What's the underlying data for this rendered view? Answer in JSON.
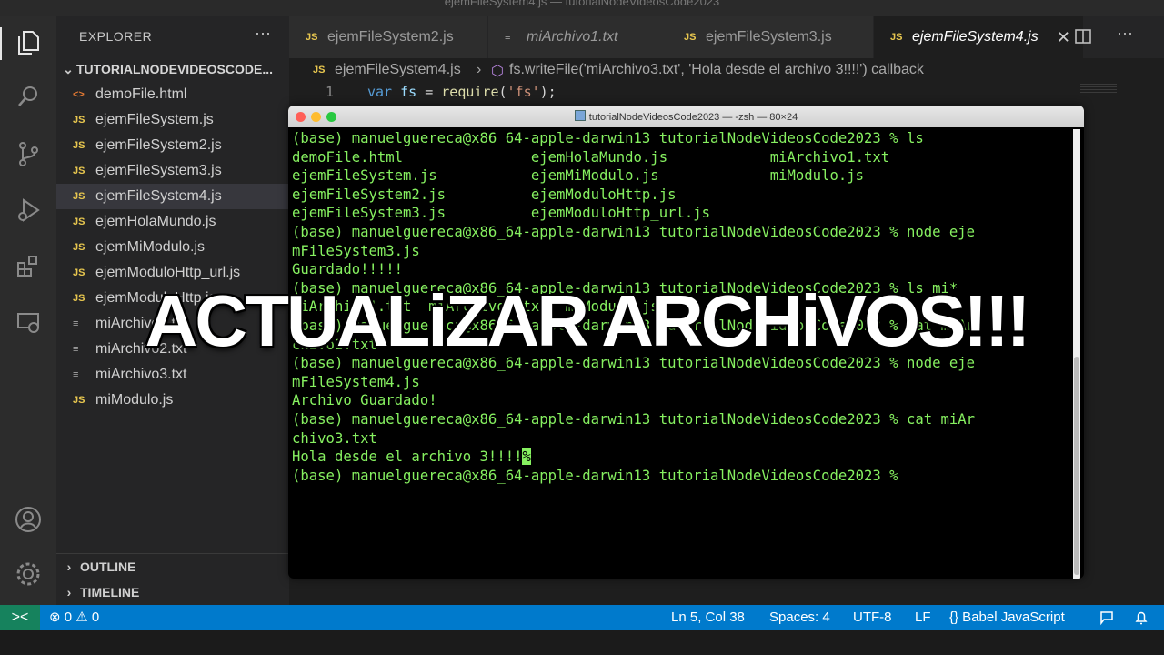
{
  "window": {
    "title": "ejemFileSystem4.js — tutorialNodeVideosCode2023"
  },
  "explorer": {
    "header": "EXPLORER",
    "more": "···",
    "folder": "TUTORIALNODEVIDEOSCODE...",
    "files": [
      {
        "name": "demoFile.html",
        "icon": "<>"
      },
      {
        "name": "ejemFileSystem.js",
        "icon": "JS"
      },
      {
        "name": "ejemFileSystem2.js",
        "icon": "JS"
      },
      {
        "name": "ejemFileSystem3.js",
        "icon": "JS"
      },
      {
        "name": "ejemFileSystem4.js",
        "icon": "JS"
      },
      {
        "name": "ejemHolaMundo.js",
        "icon": "JS"
      },
      {
        "name": "ejemMiModulo.js",
        "icon": "JS"
      },
      {
        "name": "ejemModuloHttp_url.js",
        "icon": "JS"
      },
      {
        "name": "ejemModuloHttp.js",
        "icon": "JS"
      },
      {
        "name": "miArchivo1.txt",
        "icon": "≡"
      },
      {
        "name": "miArchivo2.txt",
        "icon": "≡"
      },
      {
        "name": "miArchivo3.txt",
        "icon": "≡"
      },
      {
        "name": "miModulo.js",
        "icon": "JS"
      }
    ],
    "outline": "OUTLINE",
    "timeline": "TIMELINE"
  },
  "tabs": [
    {
      "label": "ejemFileSystem2.js",
      "icon": "JS"
    },
    {
      "label": "miArchivo1.txt",
      "icon": "≡"
    },
    {
      "label": "ejemFileSystem3.js",
      "icon": "JS"
    },
    {
      "label": "ejemFileSystem4.js",
      "icon": "JS",
      "close": "✕"
    }
  ],
  "breadcrumb": {
    "file": "ejemFileSystem4.js",
    "sep": "›",
    "symbol": "fs.writeFile('miArchivo3.txt', 'Hola desde el archivo 3!!!!') callback"
  },
  "editor": {
    "line_number": "1",
    "code": {
      "kw": "var",
      "var": "fs",
      "eq": " = ",
      "fn": "require",
      "open": "(",
      "str": "'fs'",
      "close": ");"
    }
  },
  "terminal": {
    "title": "tutorialNodeVideosCode2023 — -zsh — 80×24",
    "lines": [
      "(base) manuelguereca@x86_64-apple-darwin13 tutorialNodeVideosCode2023 % ls",
      "demoFile.html               ejemHolaMundo.js            miArchivo1.txt",
      "ejemFileSystem.js           ejemMiModulo.js             miModulo.js",
      "ejemFileSystem2.js          ejemModuloHttp.js",
      "ejemFileSystem3.js          ejemModuloHttp_url.js",
      "(base) manuelguereca@x86_64-apple-darwin13 tutorialNodeVideosCode2023 % node eje",
      "mFileSystem3.js",
      "Guardado!!!!!",
      "(base) manuelguereca@x86_64-apple-darwin13 tutorialNodeVideosCode2023 % ls mi*",
      "miArchivo1.txt  miArchivo2.txt  miModulo.js",
      "(base) manuelguereca@x86_64-apple-darwin13 tutorialNodeVideosCode2023 % cat miAr",
      "chivo2.txt",
      "(base) manuelguereca@x86_64-apple-darwin13 tutorialNodeVideosCode2023 % node eje",
      "mFileSystem4.js",
      "Archivo Guardado!",
      "(base) manuelguereca@x86_64-apple-darwin13 tutorialNodeVideosCode2023 % cat miAr",
      "chivo3.txt",
      "Hola desde el archivo 3!!!!"
    ],
    "cursor_char": "%",
    "last_line": "(base) manuelguereca@x86_64-apple-darwin13 tutorialNodeVideosCode2023 %"
  },
  "overlay_text": "ACTUALiZAR ARCHiVOS!!!",
  "statusbar": {
    "remote": "><",
    "problems": "⊗ 0 ⚠ 0",
    "position": "Ln 5, Col 38",
    "spaces": "Spaces: 4",
    "encoding": "UTF-8",
    "eol": "LF",
    "language": "{} Babel JavaScript"
  },
  "colors": {
    "accent": "#007acc",
    "terminal_text": "#86f060",
    "js_icon": "#e8c74f"
  }
}
